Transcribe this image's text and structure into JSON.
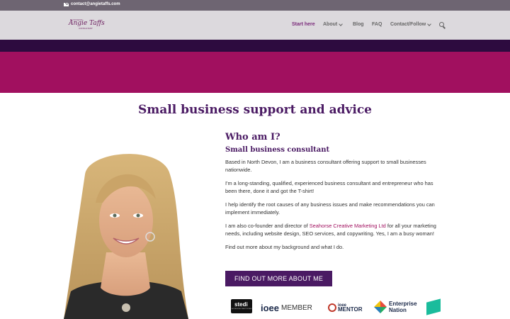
{
  "topbar": {
    "email": "contact@angietaffs.com",
    "mail_icon": "envelope-icon"
  },
  "header": {
    "logo": {
      "small_text": "BUSINESS",
      "script_text": "Angie Taffs",
      "tagline": "CONSULTANT"
    },
    "nav": [
      {
        "label": "Start here",
        "active": true,
        "has_dropdown": false
      },
      {
        "label": "About",
        "active": false,
        "has_dropdown": true
      },
      {
        "label": "Blog",
        "active": false,
        "has_dropdown": false
      },
      {
        "label": "FAQ",
        "active": false,
        "has_dropdown": false
      },
      {
        "label": "Contact/Follow",
        "active": false,
        "has_dropdown": true
      }
    ],
    "search_icon": "search-icon"
  },
  "colors": {
    "topbar": "#6e6572",
    "header": "#dcd9dd",
    "band_dark": "#2d0b3f",
    "band_pink": "#a1105f",
    "heading": "#4a1a63",
    "link": "#a1105f"
  },
  "main": {
    "title": "Small business support and advice",
    "heading": "Who am I?",
    "subheading": "Small business consultant",
    "paragraphs": [
      "Based in North Devon, I am a business consultant offering support to small businesses nationwide.",
      "I'm a long-standing, qualified, experienced business consultant and entrepreneur who has been there, done it and got the T-shirt!",
      "I help identify the root causes of any business issues and make recommendations you can implement immediately."
    ],
    "cofounder": {
      "before": "I am also co-founder and director of ",
      "link": "Seahorse Creative Marketing Ltd",
      "after": " for all your marketing needs, including website design, SEO services, and copywriting. Yes, I am a busy woman!"
    },
    "find_out": "Find out more about my background and what I do.",
    "cta": "FIND OUT MORE ABOUT ME"
  },
  "logos": {
    "stedi": "stedi",
    "stedi_sub": "ACCREDITED PRACTITIONER",
    "ioee": "ioee",
    "member": "MEMBER",
    "ioee_small": "ioee",
    "mentor": "MENTOR",
    "enterprise_1": "Enterprise",
    "enterprise_2": "Nation"
  }
}
